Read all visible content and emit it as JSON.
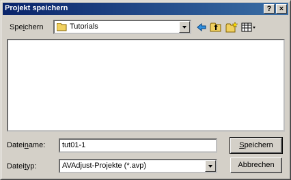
{
  "window": {
    "title": "Projekt speichern"
  },
  "titlebar_buttons": {
    "help": "?",
    "close": "×"
  },
  "toolbar": {
    "save_in_label_pre": "Spe",
    "save_in_label_ul": "i",
    "save_in_label_post": "chern",
    "save_in_value": "Tutorials",
    "icons": [
      "back-arrow-icon",
      "up-folder-icon",
      "new-folder-icon",
      "view-menu-icon"
    ]
  },
  "form": {
    "filename_label_pre": "Datei",
    "filename_label_ul": "n",
    "filename_label_post": "ame:",
    "filename_value": "tut01-1",
    "filetype_label_pre": "Datei",
    "filetype_label_ul": "t",
    "filetype_label_post": "yp:",
    "filetype_value": "AVAdjust-Projekte (*.avp)"
  },
  "buttons": {
    "save_ul": "S",
    "save_rest": "peichern",
    "cancel": "Abbrechen"
  },
  "colors": {
    "titlebar_start": "#0a246a",
    "titlebar_end": "#3a6ea5",
    "face": "#d4d0c8"
  }
}
